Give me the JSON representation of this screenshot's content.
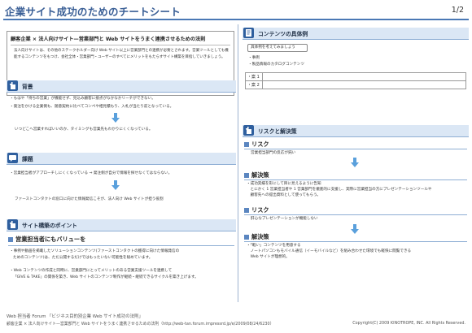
{
  "header": {
    "title": "企業サイト成功のためのチートシート",
    "page": "1/2"
  },
  "intro": {
    "heading": "顧客企業 × 法人向けサイト—営業部門と Web サイトをうまく連携させるための法則",
    "body": "法人向けサイトは、その他のステークホルダー向け Web サイト以上に営業部門との連携が必要とされます。営業ツールとしても機能するコンテンツをもつけ、会社全体・営業部門・ユーザーのすべてにメリットをもたらすサイト構築を目指していきましょう。"
  },
  "sections": {
    "background": {
      "title": "背景",
      "bullets": [
        "・もはや「待ちの営業」が機能せず、見込み顧客に接点がなかなかリーチができない。",
        "・発注をかける企業側も、随意契約に比べてコンペや相見積もり、入札が当たり前となっている。"
      ],
      "result": "いつどこへ営業すればいいのか、タイミングも営業先もわかりにくくなっている。"
    },
    "issue": {
      "title": "課題",
      "bullets": [
        "・営業担当者がアプローチしにくくなっている ⇒ 発注側が自分で情報を探せなくてはならない。"
      ],
      "result": "ファーストコンタクトの窓口に向けた情報発信こそが、法人向け Web サイトが担う役割"
    },
    "points": {
      "title": "サイト構築のポイント",
      "subhead": "営業担当者にもバリューを",
      "bullets": [
        "・事例や動画を掲載したソリューションコンテンツ(ファーストコンタクトの獲得に向けた情報発信の",
        "ためのコンテンツ)は、ただ公開するだけではもったいない可能性を秘めています。",
        "・Web コンテンツの作成と同時に、営業部門にとってメリットのある営業支援ツールを連携して",
        "「GIVE & TAKE」の関係を築き、Web サイトのコンテンツ制作が継続・継続できるサイクルを築き上げます。"
      ]
    },
    "content_example": {
      "title": "コンテンツの具体例",
      "pill": "具体例を考えてみましょう",
      "bullets": [
        "・事例",
        "・製品情報のカタログコンテンツ"
      ],
      "table": [
        {
          "key": "・案 1",
          "value": ""
        },
        {
          "key": "・案 2",
          "value": ""
        }
      ]
    },
    "risk": {
      "title": "リスクと解決策",
      "risk1_head": "リスク",
      "risk1_body": "営業担当部門の反応が鈍い",
      "sol1_head": "解決策",
      "sol1_lines": [
        "・成功実績を形にして目に見えるように告知",
        "　とにかく 1 営業担当者や 1 営業部門を徹底的に支援し、実際に営業担当の方にプレゼンテーションツールや",
        "　顧客先への提出資料として使ってもらう。"
      ],
      "risk2_head": "リスク",
      "risk2_body": "肝心なプレゼンテーションが機能しない",
      "sol2_head": "解決策",
      "sol2_lines": [
        "・「軽い」コンテンツを用意する",
        "　ノートパソコンもモバイル通信（イーモバイルなど）を組み合わせた環境でも軽快に閲覧できる",
        "　Web サイトが理想的。"
      ]
    }
  },
  "footer": {
    "line1": "Web 担当者 Forum 「ビジネス目的別企業 Web サイト成功の法則」",
    "line2": "顧客企業 × 法人向けサイト—営業部門と Web サイトをうまく連携させるための法則（http://web-tan.forum.impressrd.jp/e/2009/08/24/6230）",
    "copyright": "Copyright(C) 2009 KINOTROPE, INC. All Rights Reserved."
  },
  "colors": {
    "accent": "#3a5f96",
    "section_band": "#dbe7f5",
    "icon_bg": "#2f5f9e",
    "arrow": "#5aa0dc"
  }
}
